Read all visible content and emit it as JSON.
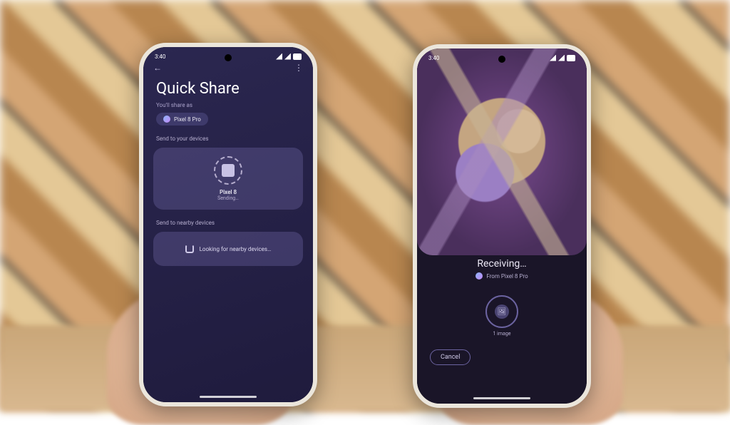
{
  "statusbar": {
    "time": "3:40"
  },
  "left_phone": {
    "title": "Quick Share",
    "share_as_label": "You'll share as",
    "share_as_device": "Pixel 8 Pro",
    "your_devices_label": "Send to your devices",
    "device": {
      "name": "Pixel 8",
      "status": "Sending…"
    },
    "nearby_label": "Send to nearby devices",
    "nearby_status": "Looking for nearby devices…"
  },
  "right_phone": {
    "status": "Receiving…",
    "from_label": "From Pixel 8 Pro",
    "item_label": "1 image",
    "cancel_label": "Cancel"
  }
}
